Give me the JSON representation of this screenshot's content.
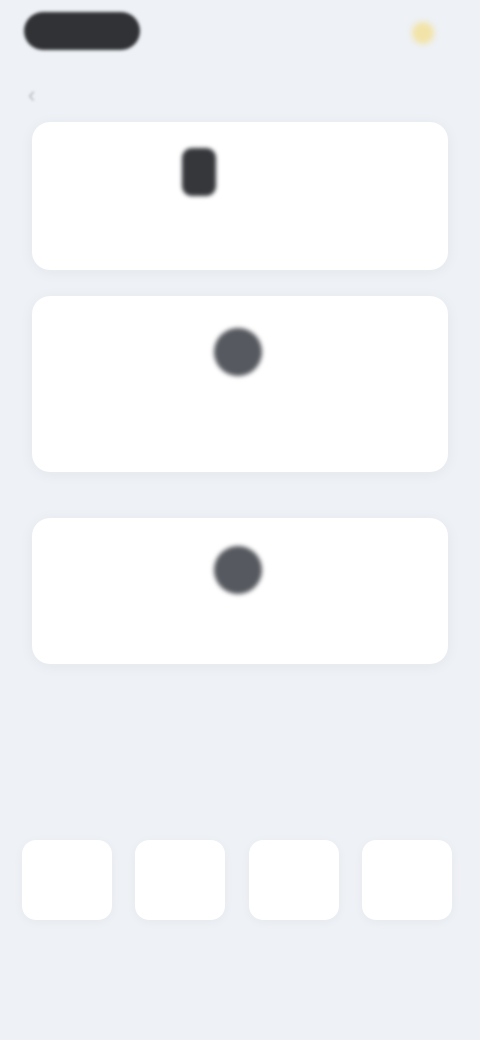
{
  "status_bar": {
    "time_pill": "",
    "indicator_icon": "sun-icon"
  },
  "nav": {
    "back_icon": "chevron-left-icon",
    "title": ""
  },
  "brand_card": {
    "logo_icon": "brand-logo-icon",
    "brand_name": "",
    "description": ""
  },
  "info_card": {
    "icon": "circle-icon",
    "description": ""
  },
  "support_card": {
    "icon": "circle-icon",
    "description": ""
  },
  "section": {
    "title": ""
  },
  "grid": [
    {
      "top": "",
      "label": ""
    },
    {
      "top": "",
      "label": ""
    },
    {
      "top": "",
      "label": ""
    },
    {
      "top": "",
      "label": ""
    }
  ],
  "colors": {
    "background": "#eef1f5",
    "card": "#ffffff",
    "text_primary": "#2a2d33",
    "text_secondary": "#6f737b",
    "accent": "#f2e3a8"
  }
}
